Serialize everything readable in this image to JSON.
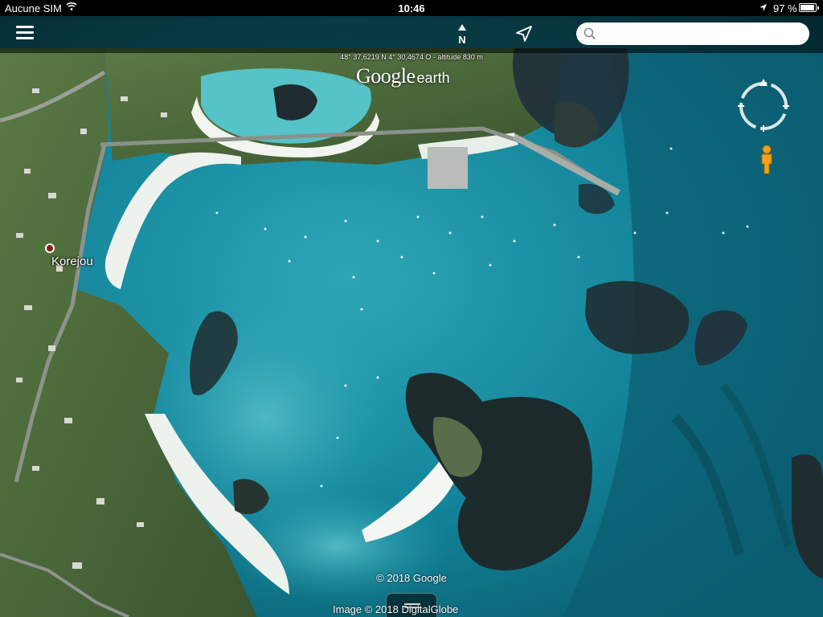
{
  "status_bar": {
    "carrier": "Aucune SIM",
    "time": "10:46",
    "battery": "97 %",
    "battery_level": 0.97,
    "wifi_icon": "wifi-icon",
    "location_icon": "location-arrow-icon"
  },
  "toolbar": {
    "menu_icon": "hamburger-menu-icon",
    "north_label": "N",
    "locate_icon": "navigation-arrow-icon",
    "search": {
      "placeholder": "",
      "value": ""
    }
  },
  "map": {
    "coordinates": "48° 37,6219 N  4° 30,4674 O - altitude 830 m",
    "logo_google": "Google",
    "logo_earth": "earth",
    "place_label": "Korejou",
    "copyright": "© 2018 Google",
    "imagery": "Image © 2018 DigitalGlobe"
  },
  "colors": {
    "water_deep": "#0b6a7a",
    "water_shallow": "#3fb6c3",
    "sand": "#e9efe8",
    "land": "#4c6a3a",
    "rock": "#1f2f33"
  }
}
